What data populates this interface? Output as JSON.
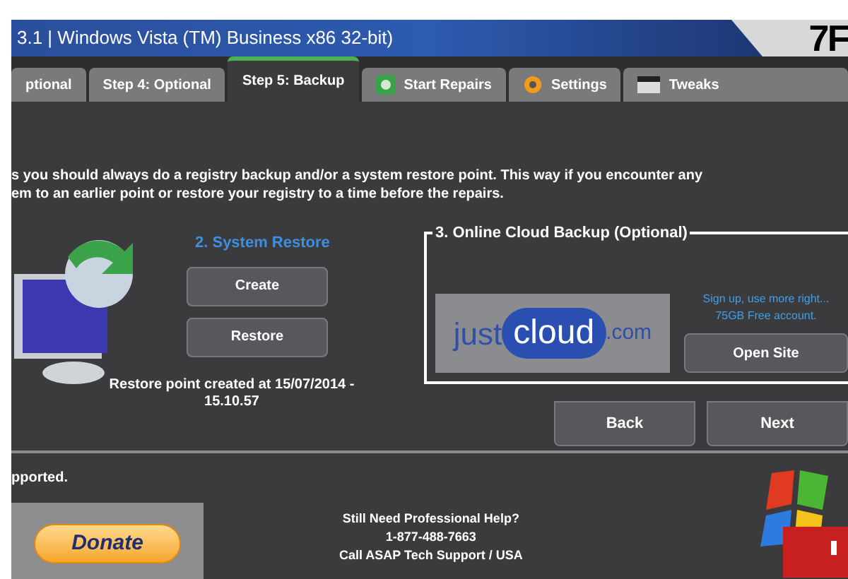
{
  "window": {
    "title": "3.1 | Windows Vista (TM) Business x86 32-bit)",
    "corner_text": "7F"
  },
  "tabs": [
    {
      "label": "ptional",
      "selected": false,
      "kind": "plain"
    },
    {
      "label": "Step 4: Optional",
      "selected": false,
      "kind": "plain"
    },
    {
      "label": "Step 5: Backup",
      "selected": true,
      "kind": "plain"
    },
    {
      "label": "Start Repairs",
      "selected": false,
      "kind": "repair"
    },
    {
      "label": "Settings",
      "selected": false,
      "kind": "gear"
    },
    {
      "label": "Tweaks",
      "selected": false,
      "kind": "window"
    }
  ],
  "intro": [
    "s you should always do a registry backup and/or a system restore point. This way if you encounter any",
    "em to an earlier point or restore your registry to a time before the repairs."
  ],
  "system_restore": {
    "heading": "2. System Restore",
    "buttons": [
      "Create",
      "Restore"
    ],
    "note": "Restore point created at 15/07/2014 -",
    "time": "15.10.57"
  },
  "cloud_backup": {
    "heading": "3. Online Cloud Backup (Optional)",
    "logo": {
      "prefix": "just",
      "word": "cloud",
      "suffix": ".com"
    },
    "promo": [
      "Sign up, use more right...",
      "75GB Free account."
    ],
    "button": "Open Site"
  },
  "nav": [
    "Back",
    "Next"
  ],
  "footer": {
    "left_text": "pported.",
    "donate": "Donate",
    "help": [
      "Still Need Professional Help?",
      "1-877-488-7663",
      "Call ASAP Tech Support / USA"
    ]
  }
}
